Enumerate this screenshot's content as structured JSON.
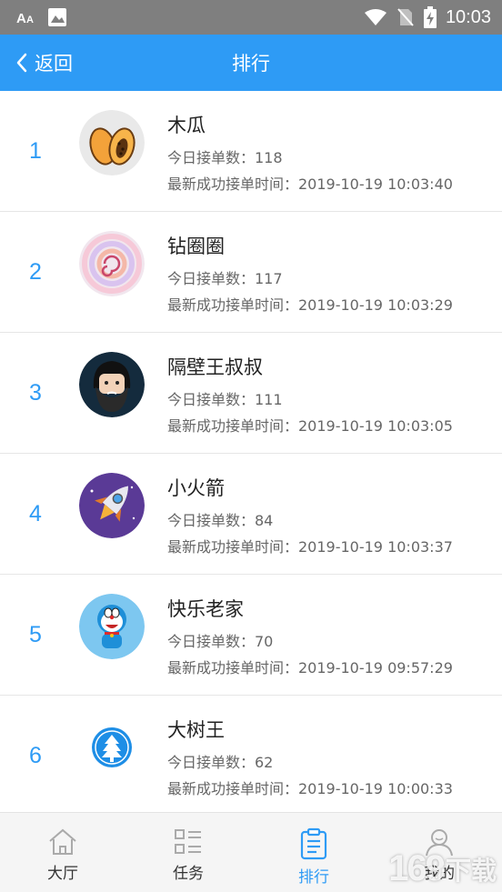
{
  "status_bar": {
    "time": "10:03",
    "icons": [
      "font-size-icon",
      "image-icon",
      "wifi-icon",
      "no-sim-icon",
      "battery-charging-icon"
    ]
  },
  "header": {
    "back_label": "返回",
    "title": "排行",
    "background": "#2e9bf5"
  },
  "ranking": [
    {
      "rank": "1",
      "name": "木瓜",
      "today": "今日接单数：118",
      "latest": "最新成功接单时间：2019-10-19 10:03:40",
      "avatar": "papaya"
    },
    {
      "rank": "2",
      "name": "钻圈圈",
      "today": "今日接单数：117",
      "latest": "最新成功接单时间：2019-10-19 10:03:29",
      "avatar": "swirl"
    },
    {
      "rank": "3",
      "name": "隔壁王叔叔",
      "today": "今日接单数：111",
      "latest": "最新成功接单时间：2019-10-19 10:03:05",
      "avatar": "bearded-man"
    },
    {
      "rank": "4",
      "name": "小火箭",
      "today": "今日接单数：84",
      "latest": "最新成功接单时间：2019-10-19 10:03:37",
      "avatar": "rocket"
    },
    {
      "rank": "5",
      "name": "快乐老家",
      "today": "今日接单数：70",
      "latest": "最新成功接单时间：2019-10-19 09:57:29",
      "avatar": "doraemon"
    },
    {
      "rank": "6",
      "name": "大树王",
      "today": "今日接单数：62",
      "latest": "最新成功接单时间：2019-10-19 10:00:33",
      "avatar": "tree"
    }
  ],
  "bottom_nav": [
    {
      "label": "大厅",
      "icon": "home-icon",
      "active": false
    },
    {
      "label": "任务",
      "icon": "task-list-icon",
      "active": false
    },
    {
      "label": "排行",
      "icon": "clipboard-icon",
      "active": true
    },
    {
      "label": "我的",
      "icon": "user-icon",
      "active": false
    }
  ],
  "watermark": {
    "number": "169",
    "text": "下载"
  }
}
